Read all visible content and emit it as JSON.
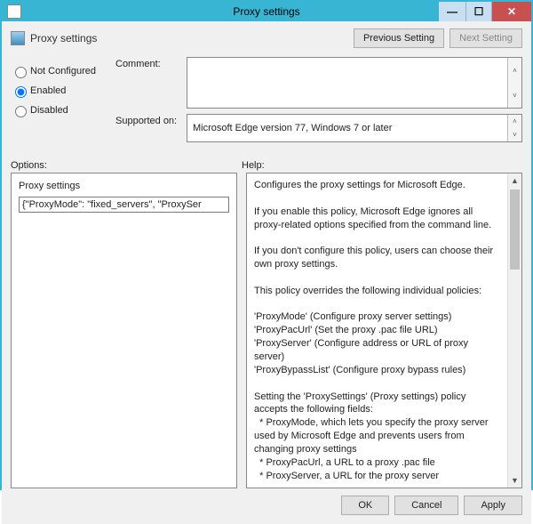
{
  "window": {
    "title": "Proxy settings",
    "header": "Proxy settings",
    "nav": {
      "previous": "Previous Setting",
      "next": "Next Setting"
    }
  },
  "config": {
    "not_configured": "Not Configured",
    "enabled": "Enabled",
    "disabled": "Disabled",
    "selected": "enabled"
  },
  "fields": {
    "comment_label": "Comment:",
    "comment_value": "",
    "supported_label": "Supported on:",
    "supported_value": "Microsoft Edge version 77, Windows 7 or later"
  },
  "labels": {
    "options": "Options:",
    "help": "Help:"
  },
  "options": {
    "subtitle": "Proxy settings",
    "value": "{\"ProxyMode\": \"fixed_servers\", \"ProxySer"
  },
  "help_text": "Configures the proxy settings for Microsoft Edge.\n\nIf you enable this policy, Microsoft Edge ignores all proxy-related options specified from the command line.\n\nIf you don't configure this policy, users can choose their own proxy settings.\n\nThis policy overrides the following individual policies:\n\n'ProxyMode' (Configure proxy server settings)\n'ProxyPacUrl' (Set the proxy .pac file URL)\n'ProxyServer' (Configure address or URL of proxy server)\n'ProxyBypassList' (Configure proxy bypass rules)\n\nSetting the 'ProxySettings' (Proxy settings) policy accepts the following fields:\n  * ProxyMode, which lets you specify the proxy server used by Microsoft Edge and prevents users from changing proxy settings\n  * ProxyPacUrl, a URL to a proxy .pac file\n  * ProxyServer, a URL for the proxy server",
  "footer": {
    "ok": "OK",
    "cancel": "Cancel",
    "apply": "Apply"
  }
}
